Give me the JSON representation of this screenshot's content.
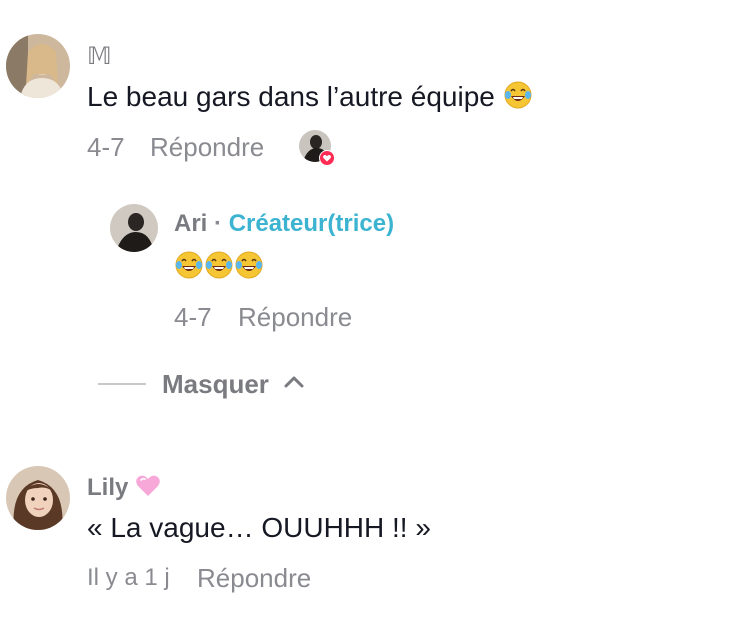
{
  "comments": [
    {
      "username": "𝕄",
      "text": "Le beau gars dans l’autre équipe",
      "text_emoji": "laughing-tears-emoji",
      "date": "4-7",
      "reply_label": "Répondre",
      "liked_by_creator": true
    },
    {
      "username": "Lily",
      "username_emoji": "pink-heart-emoji",
      "text": "« La vague… OUUHHH !! »",
      "date": "Il y a 1 j",
      "reply_label": "Répondre"
    }
  ],
  "reply": {
    "username": "Ari",
    "separator": "·",
    "badge": "Créateur(trice)",
    "text_emojis": [
      "laughing-tears-emoji",
      "laughing-tears-emoji",
      "laughing-tears-emoji"
    ],
    "date": "4-7",
    "reply_label": "Répondre"
  },
  "thread_toggle": {
    "label": "Masquer",
    "icon": "chevron-up-icon"
  },
  "colors": {
    "creator_badge": "#3cb4d1",
    "meta_text": "#8a8b91",
    "heart_badge": "#fe2c55"
  }
}
